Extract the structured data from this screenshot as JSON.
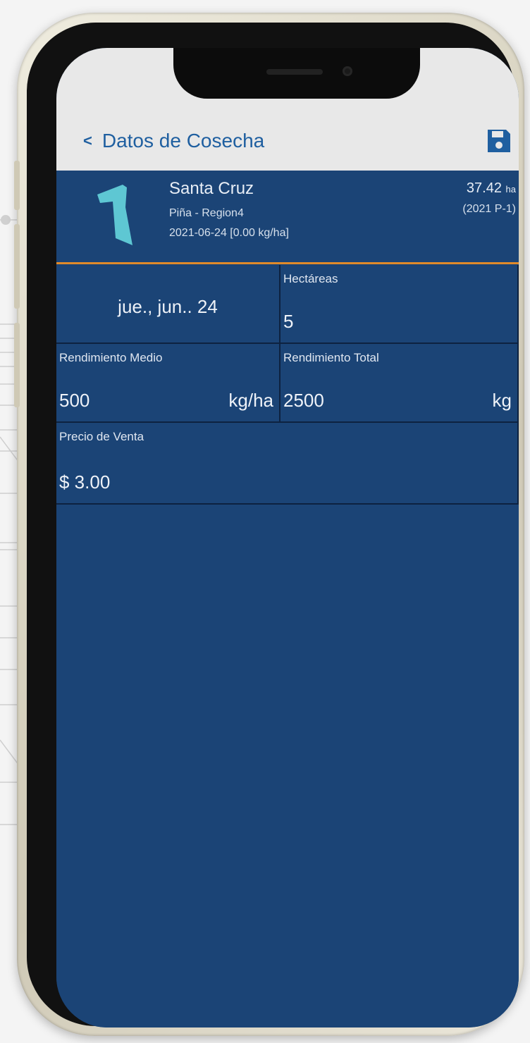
{
  "appbar": {
    "title": "Datos de Cosecha",
    "back_icon": "chevron-left-icon",
    "save_icon": "floppy-disk-icon"
  },
  "field": {
    "name": "Santa Cruz",
    "crop_region": "Piña - Region4",
    "date_yield": "2021-06-24 [0.00 kg/ha]",
    "area_value": "37.42",
    "area_unit": "ha",
    "season": "(2021 P-1)",
    "icon": "field-polygon-icon",
    "icon_color": "#5ec7d3"
  },
  "form": {
    "date": "jue., jun.. 24",
    "hectareas_label": "Hectáreas",
    "hectareas_value": "5",
    "rend_medio_label": "Rendimiento Medio",
    "rend_medio_value": "500",
    "rend_medio_unit": "kg/ha",
    "rend_total_label": "Rendimiento Total",
    "rend_total_value": "2500",
    "rend_total_unit": "kg",
    "precio_label": "Precio de Venta",
    "precio_value": "$ 3.00"
  },
  "colors": {
    "primary": "#1b4476",
    "accent": "#e08a2a",
    "link": "#1f5fa0"
  }
}
